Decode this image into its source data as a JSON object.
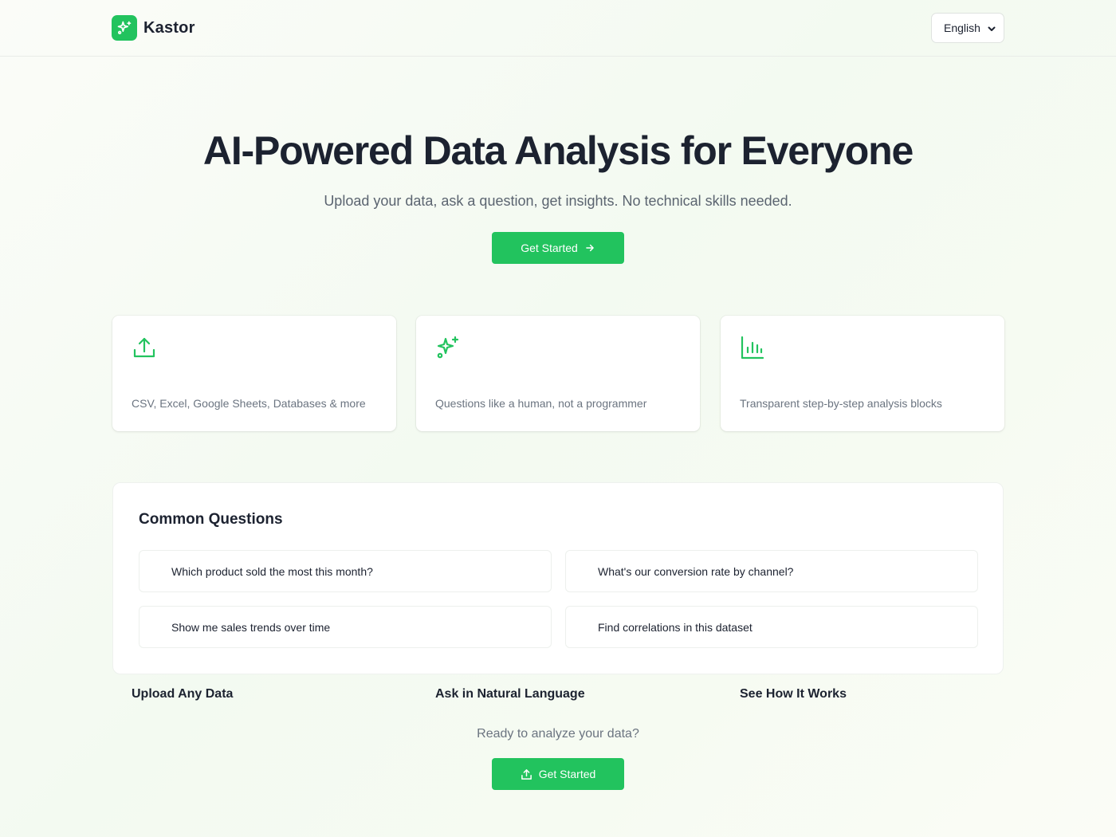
{
  "header": {
    "brand_name": "Kastor",
    "language": "English"
  },
  "hero": {
    "title": "AI-Powered Data Analysis for Everyone",
    "subtitle": "Upload your data, ask a question, get insights. No technical skills needed.",
    "cta_label": "Get Started"
  },
  "features": [
    {
      "icon": "upload-icon",
      "title": "Upload Any Data",
      "description": "CSV, Excel, Google Sheets, Databases & more"
    },
    {
      "icon": "sparkles-icon",
      "title": "Ask in Natural Language",
      "description": "Questions like a human, not a programmer"
    },
    {
      "icon": "bar-chart-icon",
      "title": "See How It Works",
      "description": "Transparent step-by-step analysis blocks"
    }
  ],
  "questions": {
    "heading": "Common Questions",
    "items": [
      "Which product sold the most this month?",
      "What's our conversion rate by channel?",
      "Show me sales trends over time",
      "Find correlations in this dataset"
    ]
  },
  "bottom_cta": {
    "text": "Ready to analyze your data?",
    "button_label": "Get Started"
  },
  "colors": {
    "accent": "#22c35e",
    "text": "#1c2230",
    "muted": "#6b7480"
  }
}
